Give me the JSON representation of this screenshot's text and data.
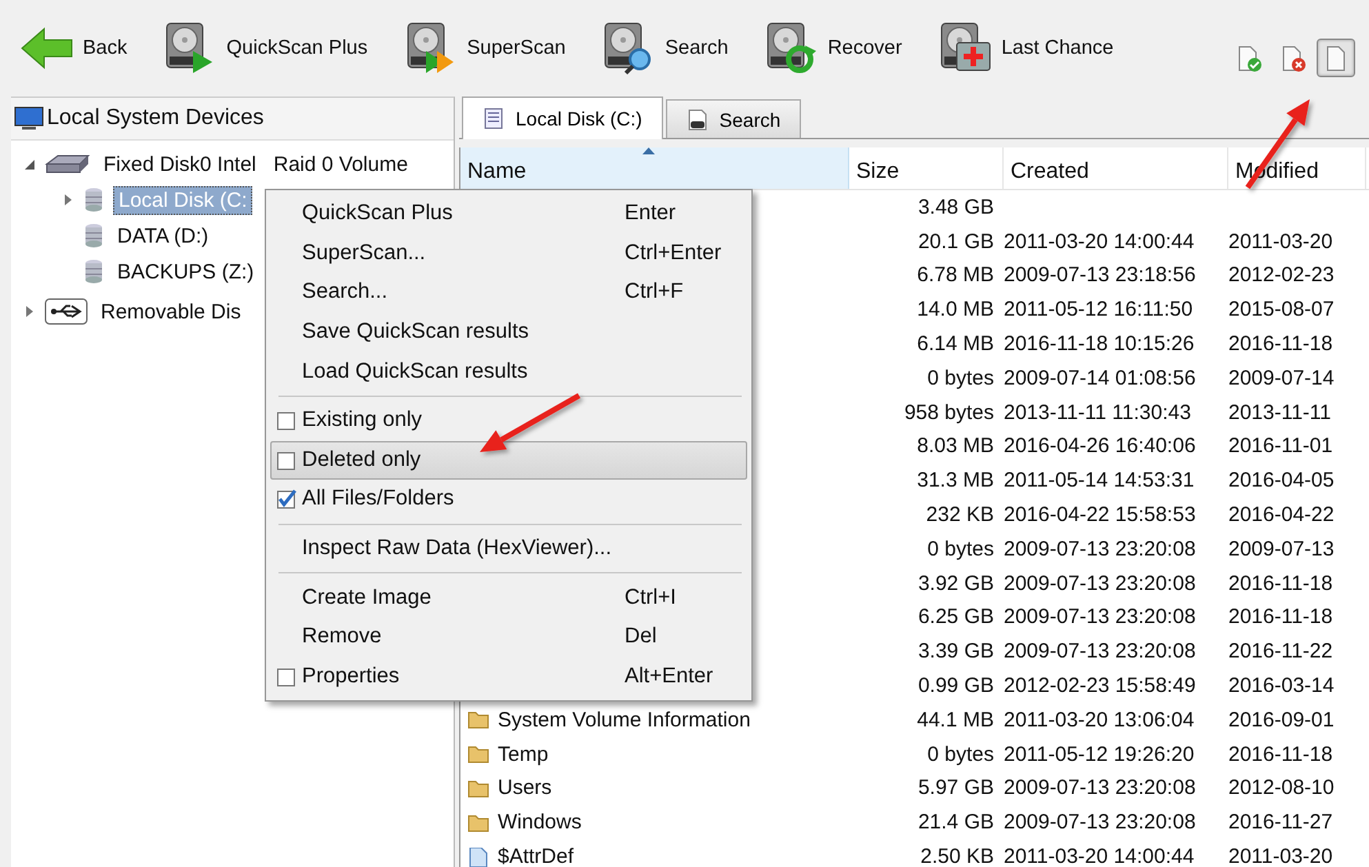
{
  "toolbar": {
    "buttons": [
      {
        "label": "Back",
        "kind": "back"
      },
      {
        "label": "QuickScan Plus",
        "kind": "quickscan"
      },
      {
        "label": "SuperScan",
        "kind": "superscan"
      },
      {
        "label": "Search",
        "kind": "search"
      },
      {
        "label": "Recover",
        "kind": "recover"
      },
      {
        "label": "Last Chance",
        "kind": "lastchance"
      }
    ],
    "view_filters": [
      {
        "kind": "existing",
        "selected": false
      },
      {
        "kind": "deleted",
        "selected": false
      },
      {
        "kind": "all",
        "selected": true
      }
    ]
  },
  "device_panel": {
    "title": "Local System Devices",
    "tree": [
      {
        "label": "Fixed Disk0 Intel   Raid 0 Volume",
        "kind": "disk",
        "expanded": true,
        "selected": false,
        "children": [
          {
            "label": "Local Disk (C:",
            "kind": "volume",
            "expanded": false,
            "selected": true
          },
          {
            "label": "DATA (D:)",
            "kind": "volume",
            "selected": false
          },
          {
            "label": "BACKUPS (Z:)",
            "kind": "volume",
            "selected": false
          }
        ]
      },
      {
        "label": "Removable Dis",
        "kind": "usb",
        "expanded": false,
        "selected": false
      }
    ]
  },
  "file_panel": {
    "tabs": [
      {
        "label": "Local Disk (C:)",
        "kind": "disk",
        "selected": true
      },
      {
        "label": "Search",
        "kind": "search",
        "selected": false
      }
    ],
    "columns": [
      {
        "label": "Name",
        "sorted": true
      },
      {
        "label": "Size",
        "sorted": false
      },
      {
        "label": "Created",
        "sorted": false
      },
      {
        "label": "Modified",
        "sorted": false
      }
    ],
    "rows": [
      {
        "size": "3.48 GB"
      },
      {
        "size": "20.1 GB",
        "created": "2011-03-20 14:00:44",
        "modified": "2011-03-20"
      },
      {
        "size": "6.78 MB",
        "created": "2009-07-13 23:18:56",
        "modified": "2012-02-23"
      },
      {
        "size": "14.0 MB",
        "created": "2011-05-12 16:11:50",
        "modified": "2015-08-07"
      },
      {
        "size": "6.14 MB",
        "created": "2016-11-18 10:15:26",
        "modified": "2016-11-18"
      },
      {
        "size": "0 bytes",
        "created": "2009-07-14 01:08:56",
        "modified": "2009-07-14"
      },
      {
        "size": "958 bytes",
        "created": "2013-11-11 11:30:43",
        "modified": "2013-11-11"
      },
      {
        "size": "8.03 MB",
        "created": "2016-04-26 16:40:06",
        "modified": "2016-11-01"
      },
      {
        "size": "31.3 MB",
        "created": "2011-05-14 14:53:31",
        "modified": "2016-04-05"
      },
      {
        "size": "232 KB",
        "created": "2016-04-22 15:58:53",
        "modified": "2016-04-22"
      },
      {
        "size": "0 bytes",
        "created": "2009-07-13 23:20:08",
        "modified": "2009-07-13"
      },
      {
        "size": "3.92 GB",
        "created": "2009-07-13 23:20:08",
        "modified": "2016-11-18"
      },
      {
        "size": "6.25 GB",
        "created": "2009-07-13 23:20:08",
        "modified": "2016-11-18"
      },
      {
        "size": "3.39 GB",
        "created": "2009-07-13 23:20:08",
        "modified": "2016-11-22"
      },
      {
        "size": "0.99 GB",
        "created": "2012-02-23 15:58:49",
        "modified": "2016-03-14"
      },
      {
        "kind": "folder",
        "name": "System Volume Information",
        "size": "44.1 MB",
        "created": "2011-03-20 13:06:04",
        "modified": "2016-09-01"
      },
      {
        "kind": "folder",
        "name": "Temp",
        "size": "0 bytes",
        "created": "2011-05-12 19:26:20",
        "modified": "2016-11-18"
      },
      {
        "kind": "folder",
        "name": "Users",
        "size": "5.97 GB",
        "created": "2009-07-13 23:20:08",
        "modified": "2012-08-10"
      },
      {
        "kind": "folder",
        "name": "Windows",
        "size": "21.4 GB",
        "created": "2009-07-13 23:20:08",
        "modified": "2016-11-27"
      },
      {
        "kind": "file",
        "name": "$AttrDef",
        "size": "2.50 KB",
        "created": "2011-03-20 14:00:44",
        "modified": "2011-03-20"
      }
    ]
  },
  "context_menu": {
    "items": [
      {
        "kind": "command",
        "label": "QuickScan Plus",
        "shortcut": "Enter",
        "highlighted": false
      },
      {
        "kind": "command",
        "label": "SuperScan...",
        "shortcut": "Ctrl+Enter",
        "highlighted": false
      },
      {
        "kind": "command",
        "label": "Search...",
        "shortcut": "Ctrl+F",
        "highlighted": false
      },
      {
        "kind": "command",
        "label": "Save QuickScan results",
        "highlighted": false
      },
      {
        "kind": "command",
        "label": "Load QuickScan results",
        "highlighted": false
      },
      {
        "kind": "separator"
      },
      {
        "kind": "check",
        "label": "Existing only",
        "checked": false,
        "highlighted": false
      },
      {
        "kind": "check",
        "label": "Deleted only",
        "checked": false,
        "highlighted": true
      },
      {
        "kind": "check",
        "label": "All Files/Folders",
        "checked": true,
        "highlighted": false
      },
      {
        "kind": "separator"
      },
      {
        "kind": "command",
        "label": "Inspect Raw Data (HexViewer)...",
        "highlighted": false
      },
      {
        "kind": "separator"
      },
      {
        "kind": "command",
        "label": "Create Image",
        "shortcut": "Ctrl+I",
        "highlighted": false
      },
      {
        "kind": "command",
        "label": "Remove",
        "shortcut": "Del",
        "highlighted": false
      },
      {
        "kind": "check",
        "label": "Properties",
        "shortcut": "Alt+Enter",
        "checked": false,
        "highlighted": false
      }
    ]
  },
  "callouts": [
    {
      "kind": "arrow"
    },
    {
      "kind": "arrow"
    }
  ]
}
